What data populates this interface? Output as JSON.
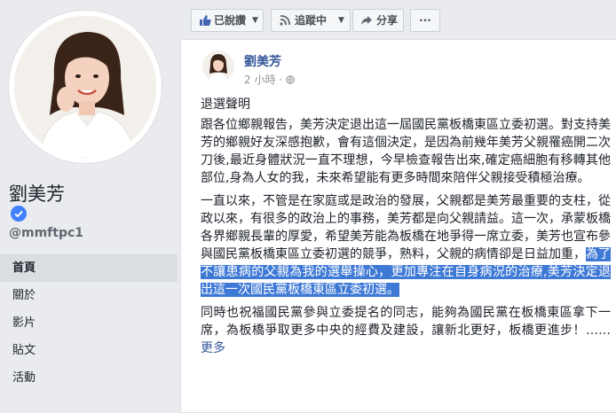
{
  "profile": {
    "name": "劉美芳",
    "handle": "@mmftpc1",
    "verified": true,
    "avatar_icon": "profile-photo"
  },
  "nav": {
    "items": [
      {
        "label": "首頁",
        "active": true
      },
      {
        "label": "關於",
        "active": false
      },
      {
        "label": "影片",
        "active": false
      },
      {
        "label": "貼文",
        "active": false
      },
      {
        "label": "活動",
        "active": false
      }
    ]
  },
  "actions": {
    "liked": {
      "label": "已說讚",
      "icon": "thumbs-up-icon"
    },
    "following": {
      "label": "追蹤中",
      "icon": "rss-icon"
    },
    "share": {
      "label": "分享",
      "icon": "share-arrow-icon"
    },
    "more": {
      "label": "···"
    }
  },
  "post": {
    "author": "劉美芳",
    "time": "2 小時 · ",
    "title": "退選聲明",
    "p1": "跟各位鄉親報告，美芳決定退出這一屆國民黨板橋東區立委初選。對支持美芳的鄉親好友深感抱歉，會有這個決定，是因為前幾年美芳父親罹癌開二次刀後,最近身體狀況一直不理想，今早檢查報告出來,確定癌細胞有移轉其他部位,身為人女的我，未來希望能有更多時間來陪伴父親接受積極治療。",
    "p2_start": "一直以來，不管是在家庭或是政治的發展，父親都是美芳最重要的支柱，從政以來，有很多的政治上的事務，美芳都是向父親請益。這一次，承蒙板橋各界鄉親長輩的厚愛，希望美芳能為板橋在地爭得一席立委，美芳也宣布參與國民黨板橋東區立委初選的競爭，熟料，父親的病情卻是日益加重，",
    "p2_highlight": "為了不讓患病的父親為我的選舉操心，更加專注在自身病況的治療,美芳決定退出這一次國民黨板橋東區立委初選。",
    "p3": "同時也祝福國民黨參與立委提名的同志，能夠為國民黨在板橋東區拿下一席，為板橋爭取更多中央的經費及建設，讓新北更好，板橋更進步！…… ",
    "more_label": "更多"
  },
  "colors": {
    "link": "#365899",
    "highlight": "#3f79d6",
    "verified": "#4080ff",
    "background": "#e9ebee"
  }
}
